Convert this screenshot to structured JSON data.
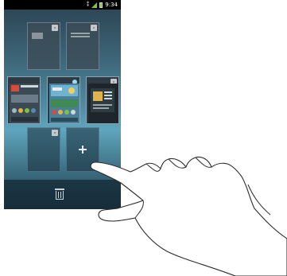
{
  "status_bar": {
    "time": "9:34",
    "icons": [
      "bluetooth-icon",
      "signal-icon",
      "battery-icon"
    ]
  },
  "pages": [
    {
      "name": "panel-top-left",
      "type": "widget-panel"
    },
    {
      "name": "panel-top-right",
      "type": "text-panel"
    },
    {
      "name": "panel-mid-left",
      "type": "home-screen"
    },
    {
      "name": "panel-mid-center",
      "type": "home-screen-active"
    },
    {
      "name": "panel-mid-right",
      "type": "home-screen"
    },
    {
      "name": "panel-bottom-left",
      "type": "empty"
    },
    {
      "name": "panel-add",
      "type": "add-page"
    }
  ],
  "actions": {
    "add_icon": "plus-icon",
    "delete_icon": "trash-icon"
  },
  "colors": {
    "accent": "#4f8fa6",
    "status_bar_bg": "#000000",
    "signal": "#7ec242"
  }
}
